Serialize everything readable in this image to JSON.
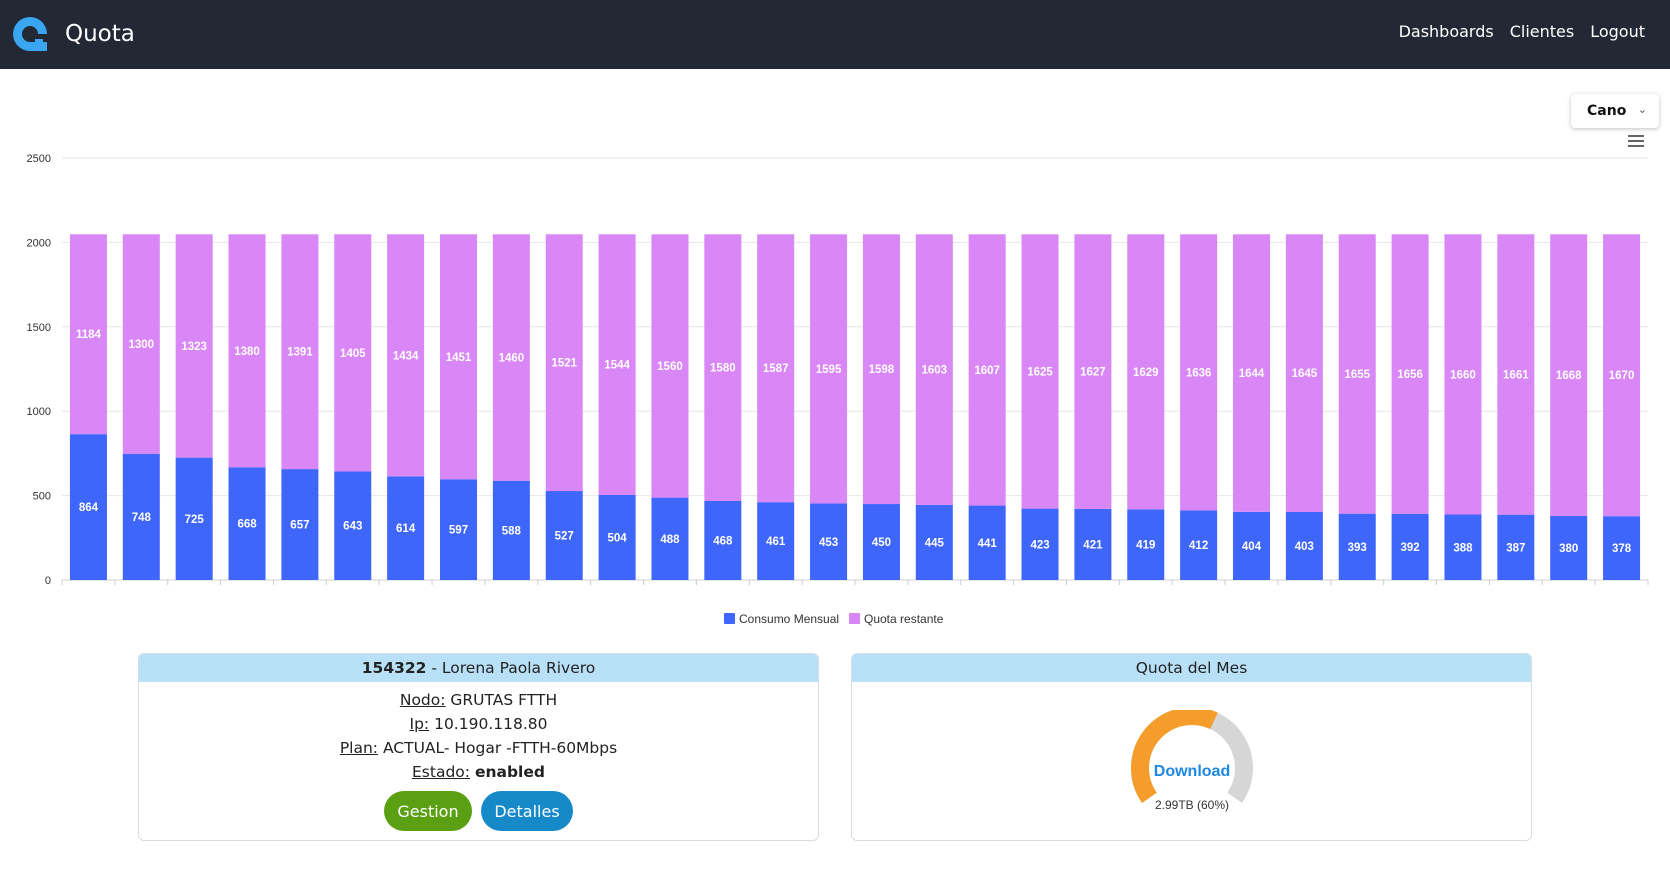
{
  "app": {
    "name": "Quota"
  },
  "nav": {
    "items": [
      "Dashboards",
      "Clientes",
      "Logout"
    ]
  },
  "filter": {
    "selected": "Cano"
  },
  "colors": {
    "consumo": "#3e66fb",
    "quota": "#d986f7",
    "topbar": "#222834",
    "gauge_fill": "#f59d2b",
    "gauge_track": "#d6d6d6",
    "download_text": "#1e88e5"
  },
  "chart_data": {
    "type": "bar",
    "stacked": true,
    "ylim": [
      0,
      2500
    ],
    "yticks": [
      0,
      500,
      1000,
      1500,
      2000,
      2500
    ],
    "grid": true,
    "legend_position": "bottom",
    "categories": [
      "",
      "",
      "",
      "",
      "",
      "",
      "",
      "",
      "",
      "",
      "",
      "",
      "",
      "",
      "",
      "",
      "",
      "",
      "",
      "",
      "",
      "",
      "",
      "",
      "",
      "",
      "",
      "",
      "",
      ""
    ],
    "series": [
      {
        "name": "Consumo Mensual",
        "color": "#3e66fb",
        "values": [
          864,
          748,
          725,
          668,
          657,
          643,
          614,
          597,
          588,
          527,
          504,
          488,
          468,
          461,
          453,
          450,
          445,
          441,
          423,
          421,
          419,
          412,
          404,
          403,
          393,
          392,
          388,
          387,
          380,
          378
        ]
      },
      {
        "name": "Quota restante",
        "color": "#d986f7",
        "values": [
          1184,
          1300,
          1323,
          1380,
          1391,
          1405,
          1434,
          1451,
          1460,
          1521,
          1544,
          1560,
          1580,
          1587,
          1595,
          1598,
          1603,
          1607,
          1625,
          1627,
          1629,
          1636,
          1644,
          1645,
          1655,
          1656,
          1660,
          1661,
          1668,
          1670
        ]
      }
    ]
  },
  "client": {
    "id": "154322",
    "name_sep": " - Lorena Paola Rivero",
    "nodo_label": "Nodo:",
    "nodo": "GRUTAS FTTH",
    "ip_label": "Ip:",
    "ip": "10.190.118.80",
    "plan_label": "Plan:",
    "plan": "ACTUAL- Hogar -FTTH-60Mbps",
    "estado_label": "Estado:",
    "estado": "enabled",
    "gestion_button": "Gestion",
    "detalles_button": "Detalles"
  },
  "quota": {
    "title": "Quota del Mes",
    "gauge_label": "Download",
    "gauge_value": "2.99TB (60%)",
    "percent": 60
  }
}
